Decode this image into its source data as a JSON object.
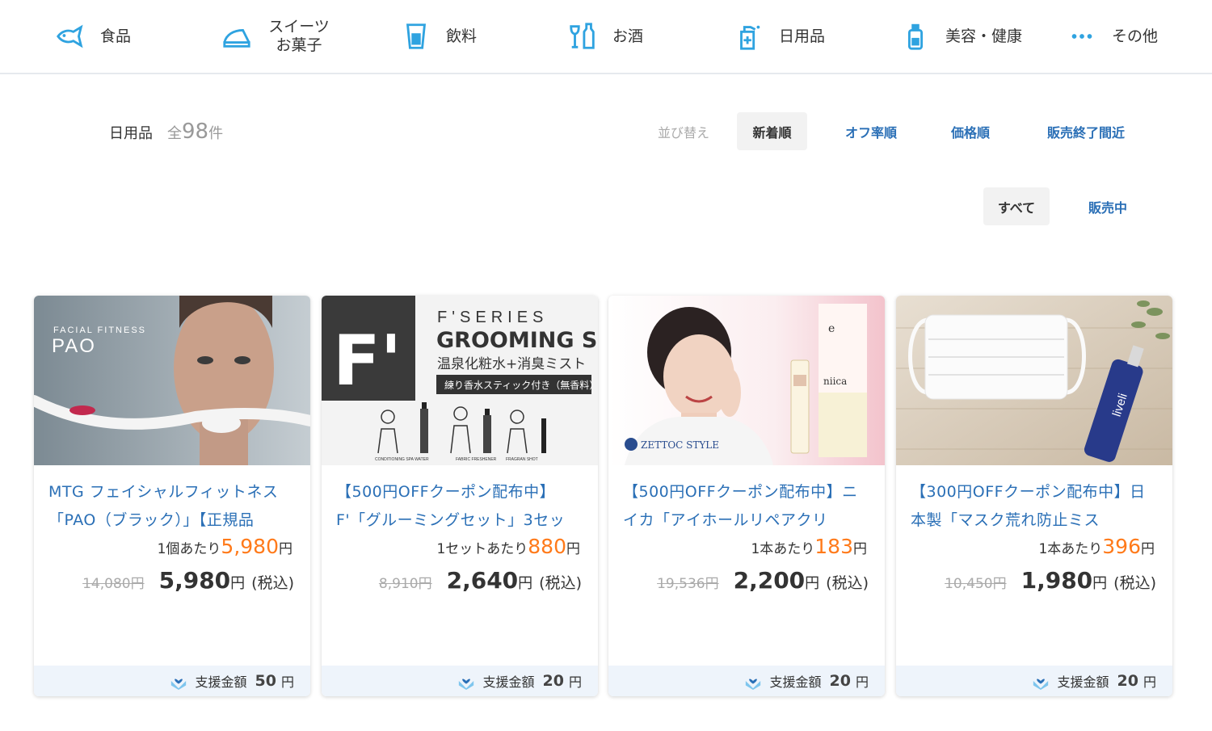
{
  "nav": [
    {
      "label": "食品",
      "icon": "fish-icon"
    },
    {
      "label": "スイーツ",
      "label2": "お菓子",
      "icon": "cake-icon"
    },
    {
      "label": "飲料",
      "icon": "cup-icon"
    },
    {
      "label": "お酒",
      "icon": "liquor-icon"
    },
    {
      "label": "日用品",
      "icon": "spray-bottle-icon"
    },
    {
      "label": "美容・健康",
      "icon": "cosmetic-bottle-icon"
    },
    {
      "label": "その他",
      "icon": "more-dots-icon"
    }
  ],
  "header": {
    "category": "日用品",
    "count_prefix": "全",
    "count": "98",
    "count_suffix": "件",
    "sort_label": "並び替え",
    "sort": [
      "新着順",
      "オフ率順",
      "価格順",
      "販売終了間近"
    ],
    "filter": [
      "すべて",
      "販売中"
    ]
  },
  "colors": {
    "accent": "#2a6fb6",
    "price_orange": "#ff7a1a",
    "support_bg": "#eef4fb"
  },
  "products": [
    {
      "title": "MTG フェイシャルフィットネス「PAO（ブラック）」【正規品",
      "unit_prefix": "1個あたり",
      "unit_price": "5,980",
      "unit_suffix": "円",
      "old_price": "14,080円",
      "price": "5,980",
      "yen": "円",
      "tax": "(税込)",
      "support_label": "支援金額",
      "support_amount": "50",
      "support_yen": "円",
      "image": {
        "line1": "FACIAL FITNESS",
        "line2": "PAO"
      }
    },
    {
      "title": "【500円OFFクーポン配布中】F'「グルーミングセット」3セッ",
      "unit_prefix": "1セットあたり",
      "unit_price": "880",
      "unit_suffix": "円",
      "old_price": "8,910円",
      "price": "2,640",
      "yen": "円",
      "tax": "(税込)",
      "support_label": "支援金額",
      "support_amount": "20",
      "support_yen": "円",
      "image": {
        "mark": "F'",
        "line1": "F'SERIES",
        "line2": "GROOMING SET",
        "line3": "温泉化粧水+消臭ミスト",
        "line4": "練り香水スティック付き（無香料）",
        "cap1": "CONDITIONING SPA WATER",
        "cap2": "FABRIC FRESHENER",
        "cap3": "FRAGRAN SHOT"
      }
    },
    {
      "title": "【500円OFFクーポン配布中】ニイカ「アイホールリペアクリ",
      "unit_prefix": "1本あたり",
      "unit_price": "183",
      "unit_suffix": "円",
      "old_price": "19,536円",
      "price": "2,200",
      "yen": "円",
      "tax": "(税込)",
      "support_label": "支援金額",
      "support_amount": "20",
      "support_yen": "円",
      "image": {
        "brand": "ZETTOC STYLE",
        "box": "niica"
      }
    },
    {
      "title": "【300円OFFクーポン配布中】日本製「マスク荒れ防止ミス",
      "unit_prefix": "1本あたり",
      "unit_price": "396",
      "unit_suffix": "円",
      "old_price": "10,450円",
      "price": "1,980",
      "yen": "円",
      "tax": "(税込)",
      "support_label": "支援金額",
      "support_amount": "20",
      "support_yen": "円",
      "image": {
        "bottle": "liveli"
      }
    }
  ]
}
